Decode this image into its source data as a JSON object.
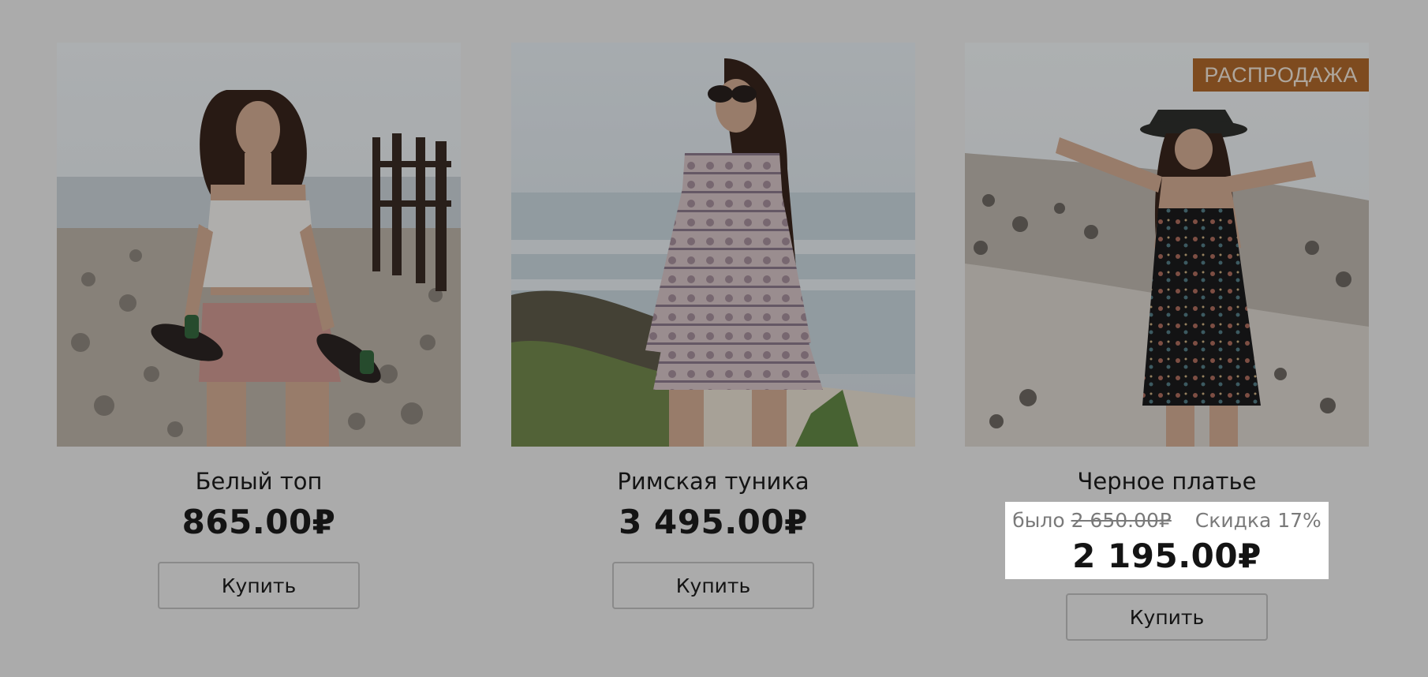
{
  "products": [
    {
      "title": "Белый топ",
      "price": "865.00₽",
      "buy_label": "Купить",
      "image": "woman-white-crop-top-skateboard-beach"
    },
    {
      "title": "Римская туника",
      "price": "3 495.00₽",
      "buy_label": "Купить",
      "image": "woman-patterned-romper-sunglasses-beach"
    },
    {
      "title": "Черное платье",
      "badge": "РАСПРОДАЖА",
      "old_price_prefix": "было",
      "old_price": "2 650.00₽",
      "discount": "Скидка 17%",
      "price": "2 195.00₽",
      "buy_label": "Купить",
      "image": "woman-black-floral-dress-hat-beach"
    }
  ],
  "colors": {
    "overlay_background": "#ababab",
    "badge_background": "#b9661f",
    "price_box_background": "#ffffff"
  }
}
